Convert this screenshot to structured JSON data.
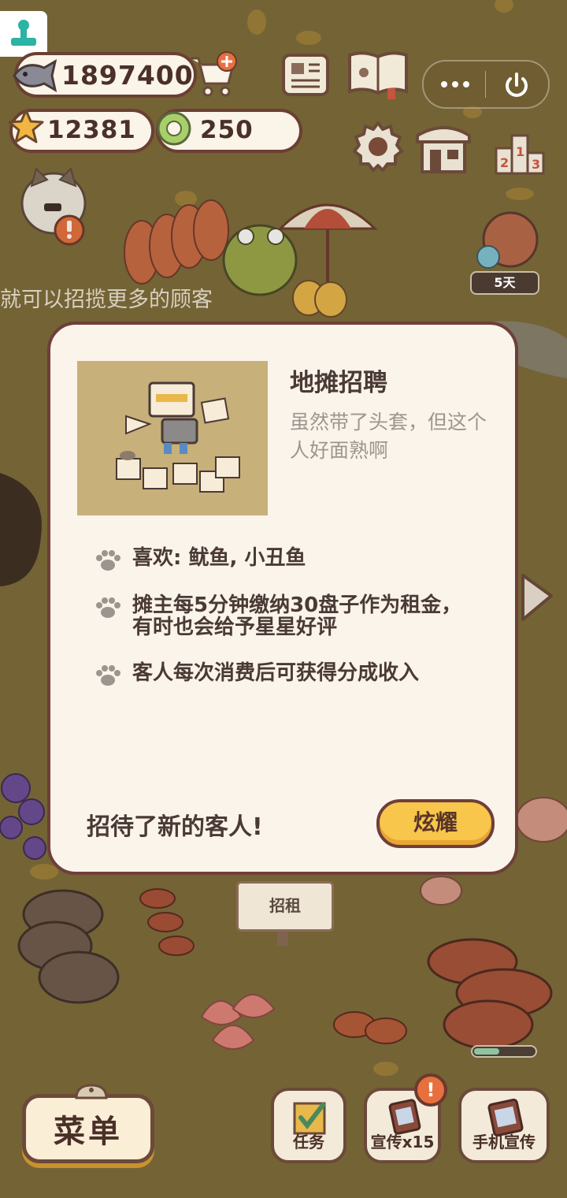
{
  "hud": {
    "fish_count": "1897400",
    "star_count": "12381",
    "coin_count": "250"
  },
  "scene": {
    "hint_text": "就可以招揽更多的顾客",
    "days_badge": "5天",
    "rent_sign": "招租",
    "stall_progress": 0.45
  },
  "modal": {
    "title": "地摊招聘",
    "description": "虽然带了头套，但这个人好面熟啊",
    "features": [
      "喜欢: 鱿鱼, 小丑鱼",
      "摊主每5分钟缴纳30盘子作为租金，有时也会给予星星好评",
      "客人每次消费后可获得分成收入"
    ],
    "new_guest_text": "招待了新的客人!",
    "show_button": "炫耀"
  },
  "bottom_bar": {
    "menu_label": "菜单",
    "task_label": "任务",
    "ad_label": "宣传x15",
    "phone_ad_label": "手机宣传",
    "ad_alert": "!"
  },
  "colors": {
    "background": "#7d6b3b",
    "panel": "#fbf4ea",
    "border": "#6e3f3a",
    "accent_yellow": "#f7c64a",
    "alert_orange": "#e8703e"
  }
}
